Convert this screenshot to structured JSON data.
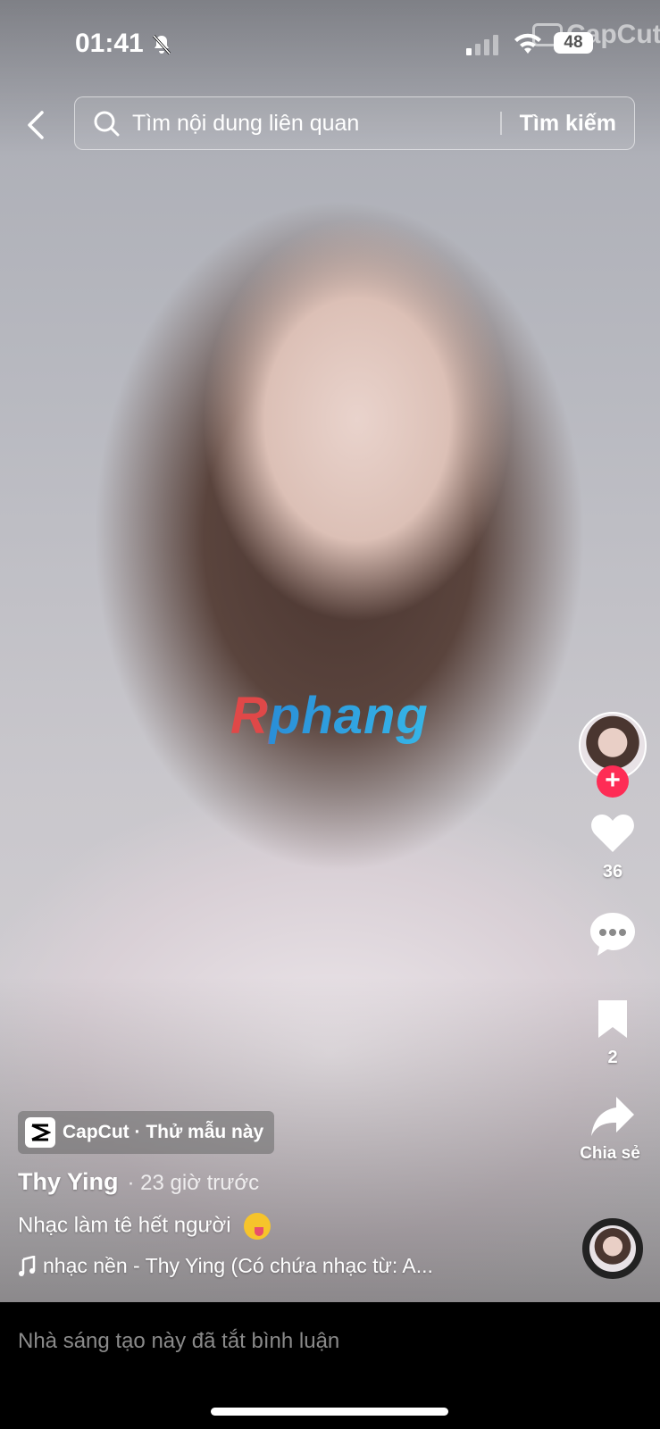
{
  "status_bar": {
    "time": "01:41",
    "battery": "48"
  },
  "watermarks": {
    "overlay_text": "Rphang",
    "capcut_text": "CapCut"
  },
  "search": {
    "placeholder": "Tìm nội dung liên quan",
    "submit_label": "Tìm kiếm"
  },
  "actions": {
    "likes": "36",
    "saves": "2",
    "share_label": "Chia sẻ"
  },
  "template_chip": {
    "label": "CapCut · Thử mẫu này"
  },
  "post": {
    "author": "Thy Ying",
    "time": "· 23 giờ trước",
    "caption": "Nhạc làm tê hết người",
    "music": "nhạc nền - Thy Ying (Có chứa nhạc từ: A..."
  },
  "footer": {
    "comments_disabled": "Nhà sáng tạo này đã tắt bình luận"
  },
  "colors": {
    "follow": "#fe2c55",
    "footer_bg": "#000000"
  }
}
